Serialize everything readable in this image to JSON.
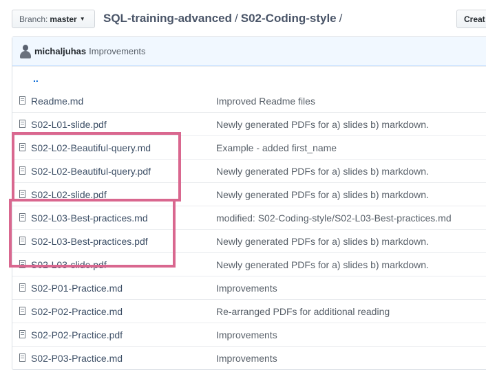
{
  "branch": {
    "label": "Branch:",
    "value": "master"
  },
  "breadcrumb": {
    "repo": "SQL-training-advanced",
    "folder": "S02-Coding-style",
    "sep": "/"
  },
  "create_button": "Creat",
  "commit": {
    "author": "michaljuhas",
    "message": "Improvements"
  },
  "parent_dir": "..",
  "files": [
    {
      "name": "Readme.md",
      "msg": "Improved Readme files"
    },
    {
      "name": "S02-L01-slide.pdf",
      "msg": "Newly generated PDFs for a) slides b) markdown."
    },
    {
      "name": "S02-L02-Beautiful-query.md",
      "msg": "Example - added first_name"
    },
    {
      "name": "S02-L02-Beautiful-query.pdf",
      "msg": "Newly generated PDFs for a) slides b) markdown."
    },
    {
      "name": "S02-L02-slide.pdf",
      "msg": "Newly generated PDFs for a) slides b) markdown."
    },
    {
      "name": "S02-L03-Best-practices.md",
      "msg": "modified: S02-Coding-style/S02-L03-Best-practices.md"
    },
    {
      "name": "S02-L03-Best-practices.pdf",
      "msg": "Newly generated PDFs for a) slides b) markdown."
    },
    {
      "name": "S02-L03-slide.pdf",
      "msg": "Newly generated PDFs for a) slides b) markdown."
    },
    {
      "name": "S02-P01-Practice.md",
      "msg": "Improvements"
    },
    {
      "name": "S02-P02-Practice.md",
      "msg": "Re-arranged PDFs for additional reading"
    },
    {
      "name": "S02-P02-Practice.pdf",
      "msg": "Improvements"
    },
    {
      "name": "S02-P03-Practice.md",
      "msg": "Improvements"
    }
  ],
  "highlight_color": "#d9678f"
}
